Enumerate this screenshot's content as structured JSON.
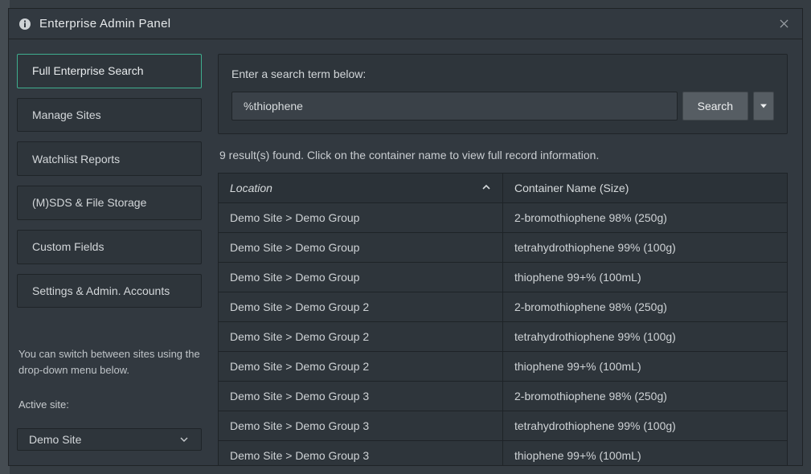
{
  "header": {
    "title": "Enterprise Admin Panel"
  },
  "sidebar": {
    "items": [
      {
        "label": "Full Enterprise Search",
        "active": true
      },
      {
        "label": "Manage Sites",
        "active": false
      },
      {
        "label": "Watchlist Reports",
        "active": false
      },
      {
        "label": "(M)SDS & File Storage",
        "active": false
      },
      {
        "label": "Custom Fields",
        "active": false
      },
      {
        "label": "Settings & Admin. Accounts",
        "active": false
      }
    ],
    "switch_note": "You can switch between sites using the drop-down menu below.",
    "active_site_label": "Active site:",
    "active_site_value": "Demo Site"
  },
  "search": {
    "prompt": "Enter a search term below:",
    "value": "%thiophene",
    "button": "Search"
  },
  "results": {
    "summary": "9 result(s) found. Click on the container name to view full record information.",
    "columns": {
      "location": "Location",
      "container": "Container Name (Size)"
    },
    "rows": [
      {
        "location": "Demo Site > Demo Group",
        "container": "2-bromothiophene 98% (250g)"
      },
      {
        "location": "Demo Site > Demo Group",
        "container": "tetrahydrothiophene 99% (100g)"
      },
      {
        "location": "Demo Site > Demo Group",
        "container": "thiophene 99+% (100mL)"
      },
      {
        "location": "Demo Site > Demo Group 2",
        "container": "2-bromothiophene 98% (250g)"
      },
      {
        "location": "Demo Site > Demo Group 2",
        "container": "tetrahydrothiophene 99% (100g)"
      },
      {
        "location": "Demo Site > Demo Group 2",
        "container": "thiophene 99+% (100mL)"
      },
      {
        "location": "Demo Site > Demo Group 3",
        "container": "2-bromothiophene 98% (250g)"
      },
      {
        "location": "Demo Site > Demo Group 3",
        "container": "tetrahydrothiophene 99% (100g)"
      },
      {
        "location": "Demo Site > Demo Group 3",
        "container": "thiophene 99+% (100mL)"
      }
    ]
  }
}
